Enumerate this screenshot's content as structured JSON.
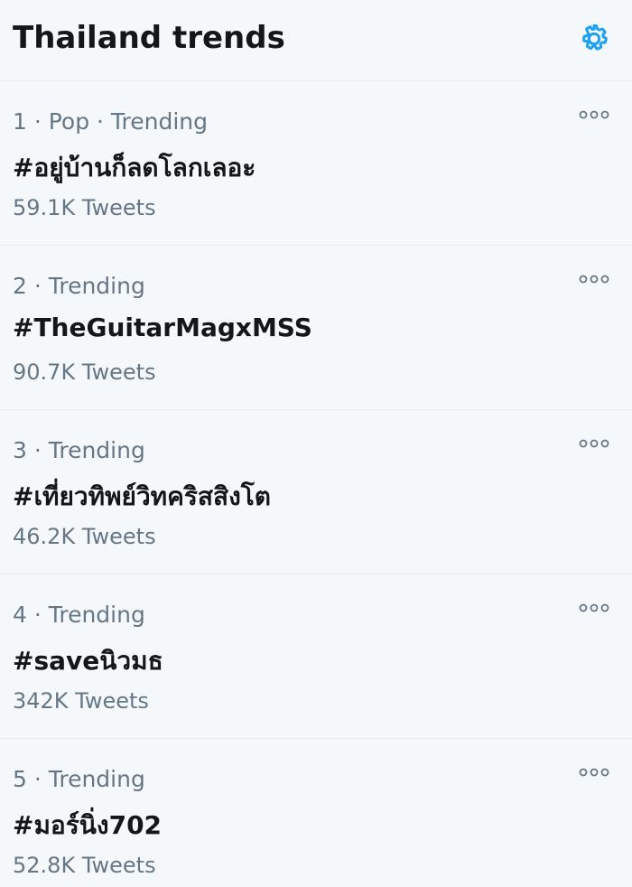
{
  "header": {
    "title": "Thailand trends",
    "settings_icon": "gear-icon"
  },
  "colors": {
    "background": "#f5f8fa",
    "accent": "#1da1f2",
    "secondary_text": "#657786",
    "primary_text": "#14171a",
    "divider": "#e6ecf0"
  },
  "trends": [
    {
      "meta": "1 · Pop · Trending",
      "name": "#อยู่บ้านก็ลดโลกเลอะ",
      "count": "59.1K Tweets",
      "more_icon": "more-icon"
    },
    {
      "meta": "2 · Trending",
      "name": "#TheGuitarMagxMSS",
      "count": "90.7K Tweets",
      "more_icon": "more-icon"
    },
    {
      "meta": "3 · Trending",
      "name": "#เที่ยวทิพย์วิทคริสสิงโต",
      "count": "46.2K Tweets",
      "more_icon": "more-icon"
    },
    {
      "meta": "4 · Trending",
      "name": "#saveนิวมธ",
      "count": "342K Tweets",
      "more_icon": "more-icon"
    },
    {
      "meta": "5 · Trending",
      "name": "#มอร์นิ่ง702",
      "count": "52.8K Tweets",
      "more_icon": "more-icon"
    }
  ]
}
